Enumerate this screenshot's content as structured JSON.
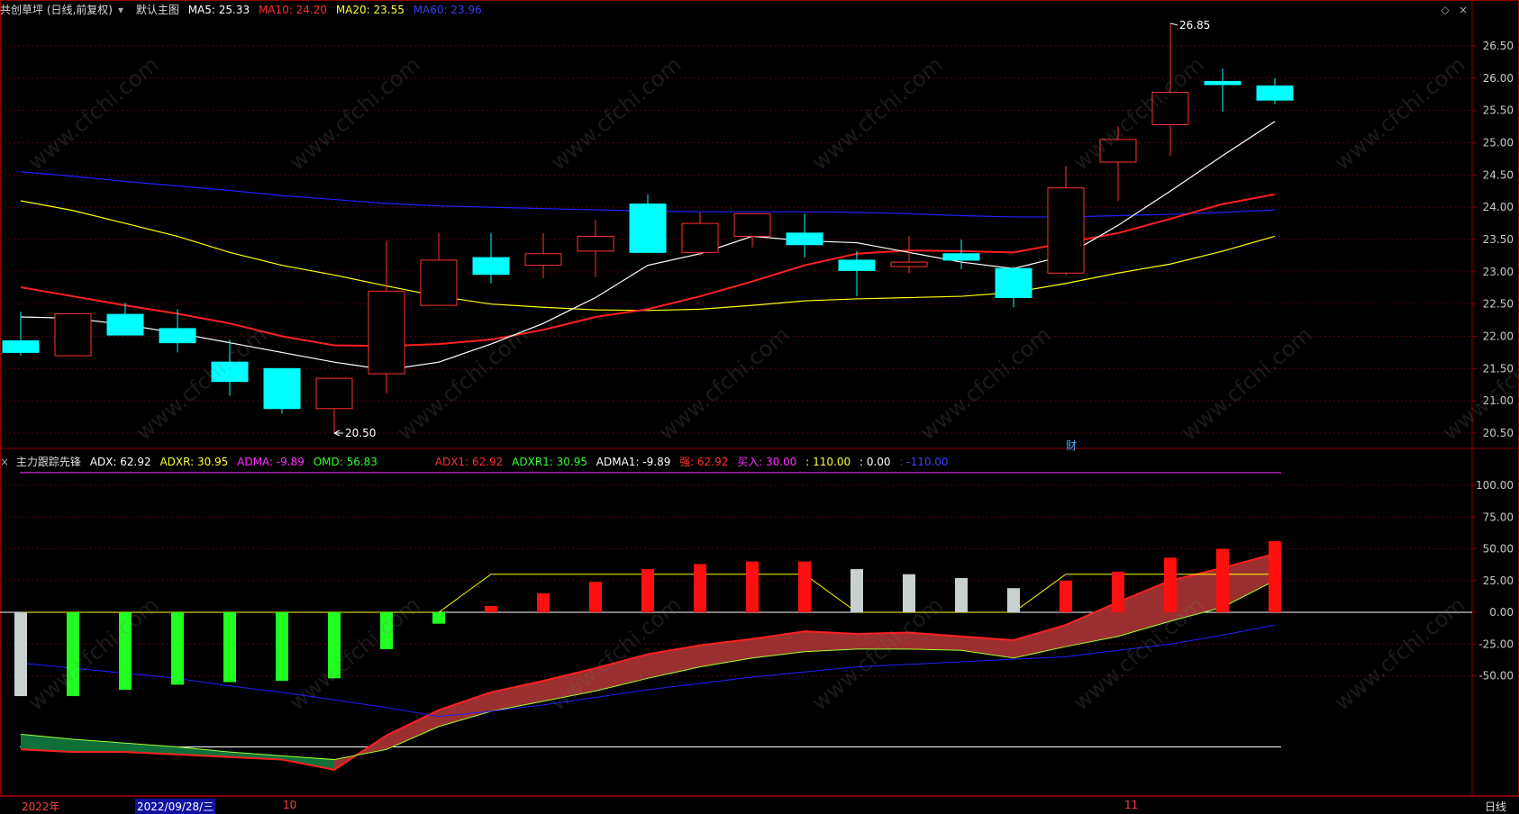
{
  "header_top": {
    "title": "共创草坪 (日线,前复权)",
    "view": "默认主图",
    "ma5": "MA5: 25.33",
    "ma10": "MA10: 24.20",
    "ma20": "MA20: 23.55",
    "ma60": "MA60: 23.96"
  },
  "header_bottom": {
    "name": "主力跟踪先锋",
    "adx": "ADX: 62.92",
    "adxr": "ADXR: 30.95",
    "adma": "ADMA: -9.89",
    "omd": "OMD: 56.83",
    "adx1": "ADX1: 62.92",
    "adxr1": "ADXR1: 30.95",
    "adma1": "ADMA1: -9.89",
    "strong": "强: 62.92",
    "buy": "买入: 30.00",
    "v110": ": 110.00",
    "v0": ": 0.00",
    "vneg110": ": -110.00"
  },
  "price_axis": [
    "26.50",
    "26.00",
    "25.50",
    "25.00",
    "24.50",
    "24.00",
    "23.50",
    "23.00",
    "22.50",
    "22.00",
    "21.50",
    "21.00",
    "20.50"
  ],
  "ind_axis": [
    "100.00",
    "75.00",
    "50.00",
    "25.00",
    "0.00",
    "-25.00",
    "-50.00"
  ],
  "annot": {
    "high": "26.85",
    "low": "20.50",
    "cai": "财"
  },
  "bottom": {
    "year": "2022年",
    "date": "2022/09/28/三",
    "oct": "10",
    "nov": "11",
    "period": "日线"
  },
  "colors": {
    "up": "#ff3232",
    "down": "#00ffff",
    "ma5": "#ffffff",
    "ma10": "#ff2020",
    "ma20": "#ffff00",
    "ma60": "#2020ff"
  },
  "chart_data": {
    "type": "candlestick",
    "candles": [
      {
        "o": 21.93,
        "c": 21.75,
        "h": 22.38,
        "l": 21.7
      },
      {
        "o": 21.7,
        "c": 22.35,
        "h": 22.35,
        "l": 21.7
      },
      {
        "o": 22.34,
        "c": 22.02,
        "h": 22.52,
        "l": 22.02
      },
      {
        "o": 22.12,
        "c": 21.9,
        "h": 22.42,
        "l": 21.75
      },
      {
        "o": 21.6,
        "c": 21.3,
        "h": 21.95,
        "l": 21.08
      },
      {
        "o": 21.5,
        "c": 20.88,
        "h": 21.5,
        "l": 20.8
      },
      {
        "o": 20.88,
        "c": 21.35,
        "h": 21.35,
        "l": 20.5
      },
      {
        "o": 21.42,
        "c": 22.7,
        "h": 23.48,
        "l": 21.12
      },
      {
        "o": 22.48,
        "c": 23.18,
        "h": 23.6,
        "l": 22.48
      },
      {
        "o": 23.22,
        "c": 22.96,
        "h": 23.6,
        "l": 22.82
      },
      {
        "o": 23.1,
        "c": 23.28,
        "h": 23.6,
        "l": 22.9
      },
      {
        "o": 23.32,
        "c": 23.55,
        "h": 23.8,
        "l": 22.92
      },
      {
        "o": 24.05,
        "c": 23.3,
        "h": 24.2,
        "l": 23.3
      },
      {
        "o": 23.3,
        "c": 23.75,
        "h": 23.92,
        "l": 23.25
      },
      {
        "o": 23.55,
        "c": 23.9,
        "h": 23.9,
        "l": 23.38
      },
      {
        "o": 23.6,
        "c": 23.42,
        "h": 23.9,
        "l": 23.22
      },
      {
        "o": 23.18,
        "c": 23.02,
        "h": 23.32,
        "l": 22.62
      },
      {
        "o": 23.08,
        "c": 23.15,
        "h": 23.55,
        "l": 22.98
      },
      {
        "o": 23.28,
        "c": 23.18,
        "h": 23.5,
        "l": 23.04
      },
      {
        "o": 23.05,
        "c": 22.6,
        "h": 23.08,
        "l": 22.45
      },
      {
        "o": 22.98,
        "c": 24.3,
        "h": 24.64,
        "l": 22.94
      },
      {
        "o": 24.7,
        "c": 25.05,
        "h": 25.25,
        "l": 24.1
      },
      {
        "o": 25.28,
        "c": 25.78,
        "h": 26.85,
        "l": 24.8
      },
      {
        "o": 25.95,
        "c": 25.9,
        "h": 26.15,
        "l": 25.48
      },
      {
        "o": 25.88,
        "c": 25.66,
        "h": 26.0,
        "l": 25.6
      }
    ],
    "ma5": [
      22.3,
      22.28,
      22.18,
      22.05,
      21.9,
      21.75,
      21.6,
      21.48,
      21.6,
      21.88,
      22.2,
      22.6,
      23.1,
      23.28,
      23.55,
      23.48,
      23.45,
      23.3,
      23.15,
      23.05,
      23.25,
      23.72,
      24.25,
      24.8,
      25.33
    ],
    "ma10": [
      22.76,
      22.62,
      22.48,
      22.35,
      22.2,
      22.0,
      21.86,
      21.85,
      21.88,
      21.95,
      22.1,
      22.3,
      22.42,
      22.62,
      22.85,
      23.1,
      23.28,
      23.33,
      23.32,
      23.3,
      23.45,
      23.6,
      23.82,
      24.05,
      24.2
    ],
    "ma20": [
      24.1,
      23.95,
      23.75,
      23.55,
      23.3,
      23.1,
      22.95,
      22.78,
      22.62,
      22.5,
      22.45,
      22.41,
      22.4,
      22.42,
      22.48,
      22.55,
      22.58,
      22.6,
      22.62,
      22.68,
      22.82,
      22.98,
      23.12,
      23.32,
      23.55
    ],
    "ma60": [
      24.55,
      24.48,
      24.4,
      24.33,
      24.26,
      24.18,
      24.12,
      24.06,
      24.02,
      24.0,
      23.98,
      23.96,
      23.94,
      23.93,
      23.93,
      23.93,
      23.92,
      23.9,
      23.87,
      23.85,
      23.85,
      23.87,
      23.89,
      23.92,
      23.96
    ],
    "ind_bars": [
      -66,
      -66,
      -61,
      -57,
      -55,
      -54,
      -52,
      -29,
      -9,
      5,
      15,
      24,
      34,
      38,
      40,
      40,
      34,
      30,
      27,
      19,
      25,
      32,
      43,
      50,
      56
    ],
    "ind_adx": [
      -96,
      -100,
      -103,
      -106,
      -110,
      -113,
      -116,
      -108,
      -90,
      -78,
      -70,
      -62,
      -52,
      -43,
      -36,
      -31,
      -29,
      -29,
      -30,
      -36,
      -27,
      -19,
      -7,
      4,
      25
    ],
    "ind_red": [
      -108,
      -110,
      -110,
      -112,
      -114,
      -116,
      -124,
      -97,
      -77,
      -63,
      -54,
      -44,
      -33,
      -26,
      -21,
      -15,
      -17,
      -16,
      -19,
      -22,
      -10,
      8,
      25,
      35,
      46
    ],
    "ind_yellow": [
      0,
      0,
      0,
      0,
      0,
      0,
      0,
      0,
      0,
      30,
      30,
      30,
      30,
      30,
      30,
      30,
      0,
      0,
      0,
      0,
      30,
      30,
      30,
      30,
      30
    ],
    "ind_blue": [
      -40,
      -44,
      -48,
      -52,
      -58,
      -63,
      -69,
      -75,
      -82,
      -78,
      -73,
      -67,
      -61,
      -56,
      -51,
      -47,
      -43,
      -41,
      -39,
      -37,
      -35,
      -30,
      -25,
      -18,
      -10
    ],
    "ind_white_level": -106
  }
}
